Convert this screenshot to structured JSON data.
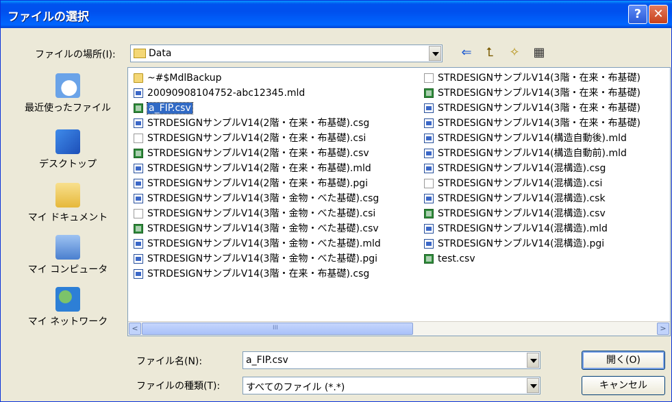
{
  "window": {
    "title": "ファイルの選択"
  },
  "lookin": {
    "label": "ファイルの場所(I):",
    "value": "Data"
  },
  "toolbar": {
    "back_icon": "back-arrow-icon",
    "up_icon": "up-folder-icon",
    "newfolder_icon": "new-folder-icon",
    "view_icon": "view-menu-icon"
  },
  "places": [
    {
      "label": "最近使ったファイル",
      "icon": "recent-icon"
    },
    {
      "label": "デスクトップ",
      "icon": "desktop-icon"
    },
    {
      "label": "マイ ドキュメント",
      "icon": "my-documents-icon"
    },
    {
      "label": "マイ コンピュータ",
      "icon": "my-computer-icon"
    },
    {
      "label": "マイ ネットワーク",
      "icon": "my-network-icon"
    }
  ],
  "files": {
    "col1": [
      {
        "name": "~#$MdlBackup",
        "type": "folder"
      },
      {
        "name": "20090908104752-abc12345.mld",
        "type": "mld"
      },
      {
        "name": "a_FIP.csv",
        "type": "csv",
        "selected": true
      },
      {
        "name": "STRDESIGNサンプルV14(2階・在来・布基礎).csg",
        "type": "mld"
      },
      {
        "name": "STRDESIGNサンプルV14(2階・在来・布基礎).csi",
        "type": "blank"
      },
      {
        "name": "STRDESIGNサンプルV14(2階・在来・布基礎).csv",
        "type": "csv"
      },
      {
        "name": "STRDESIGNサンプルV14(2階・在来・布基礎).mld",
        "type": "mld"
      },
      {
        "name": "STRDESIGNサンプルV14(2階・在来・布基礎).pgi",
        "type": "mld"
      },
      {
        "name": "STRDESIGNサンプルV14(3階・金物・べた基礎).csg",
        "type": "mld"
      },
      {
        "name": "STRDESIGNサンプルV14(3階・金物・べた基礎).csi",
        "type": "blank"
      },
      {
        "name": "STRDESIGNサンプルV14(3階・金物・べた基礎).csv",
        "type": "csv"
      },
      {
        "name": "STRDESIGNサンプルV14(3階・金物・べた基礎).mld",
        "type": "mld"
      },
      {
        "name": "STRDESIGNサンプルV14(3階・金物・べた基礎).pgi",
        "type": "mld"
      },
      {
        "name": "STRDESIGNサンプルV14(3階・在来・布基礎).csg",
        "type": "mld"
      }
    ],
    "col2": [
      {
        "name": "STRDESIGNサンプルV14(3階・在来・布基礎)",
        "type": "blank"
      },
      {
        "name": "STRDESIGNサンプルV14(3階・在来・布基礎)",
        "type": "csv"
      },
      {
        "name": "STRDESIGNサンプルV14(3階・在来・布基礎)",
        "type": "mld"
      },
      {
        "name": "STRDESIGNサンプルV14(3階・在来・布基礎)",
        "type": "mld"
      },
      {
        "name": "STRDESIGNサンプルV14(構造自動後).mld",
        "type": "mld"
      },
      {
        "name": "STRDESIGNサンプルV14(構造自動前).mld",
        "type": "mld"
      },
      {
        "name": "STRDESIGNサンプルV14(混構造).csg",
        "type": "mld"
      },
      {
        "name": "STRDESIGNサンプルV14(混構造).csi",
        "type": "blank"
      },
      {
        "name": "STRDESIGNサンプルV14(混構造).csk",
        "type": "mld"
      },
      {
        "name": "STRDESIGNサンプルV14(混構造).csv",
        "type": "csv"
      },
      {
        "name": "STRDESIGNサンプルV14(混構造).mld",
        "type": "mld"
      },
      {
        "name": "STRDESIGNサンプルV14(混構造).pgi",
        "type": "mld"
      },
      {
        "name": "test.csv",
        "type": "csv"
      }
    ]
  },
  "filename": {
    "label": "ファイル名(N):",
    "value": "a_FIP.csv"
  },
  "filetype": {
    "label": "ファイルの種類(T):",
    "value": "すべてのファイル (*.*)"
  },
  "buttons": {
    "open": "開く(O)",
    "cancel": "キャンセル"
  },
  "scrollbar": {
    "left_arrow": "<",
    "right_arrow": ">",
    "grip": "III"
  }
}
